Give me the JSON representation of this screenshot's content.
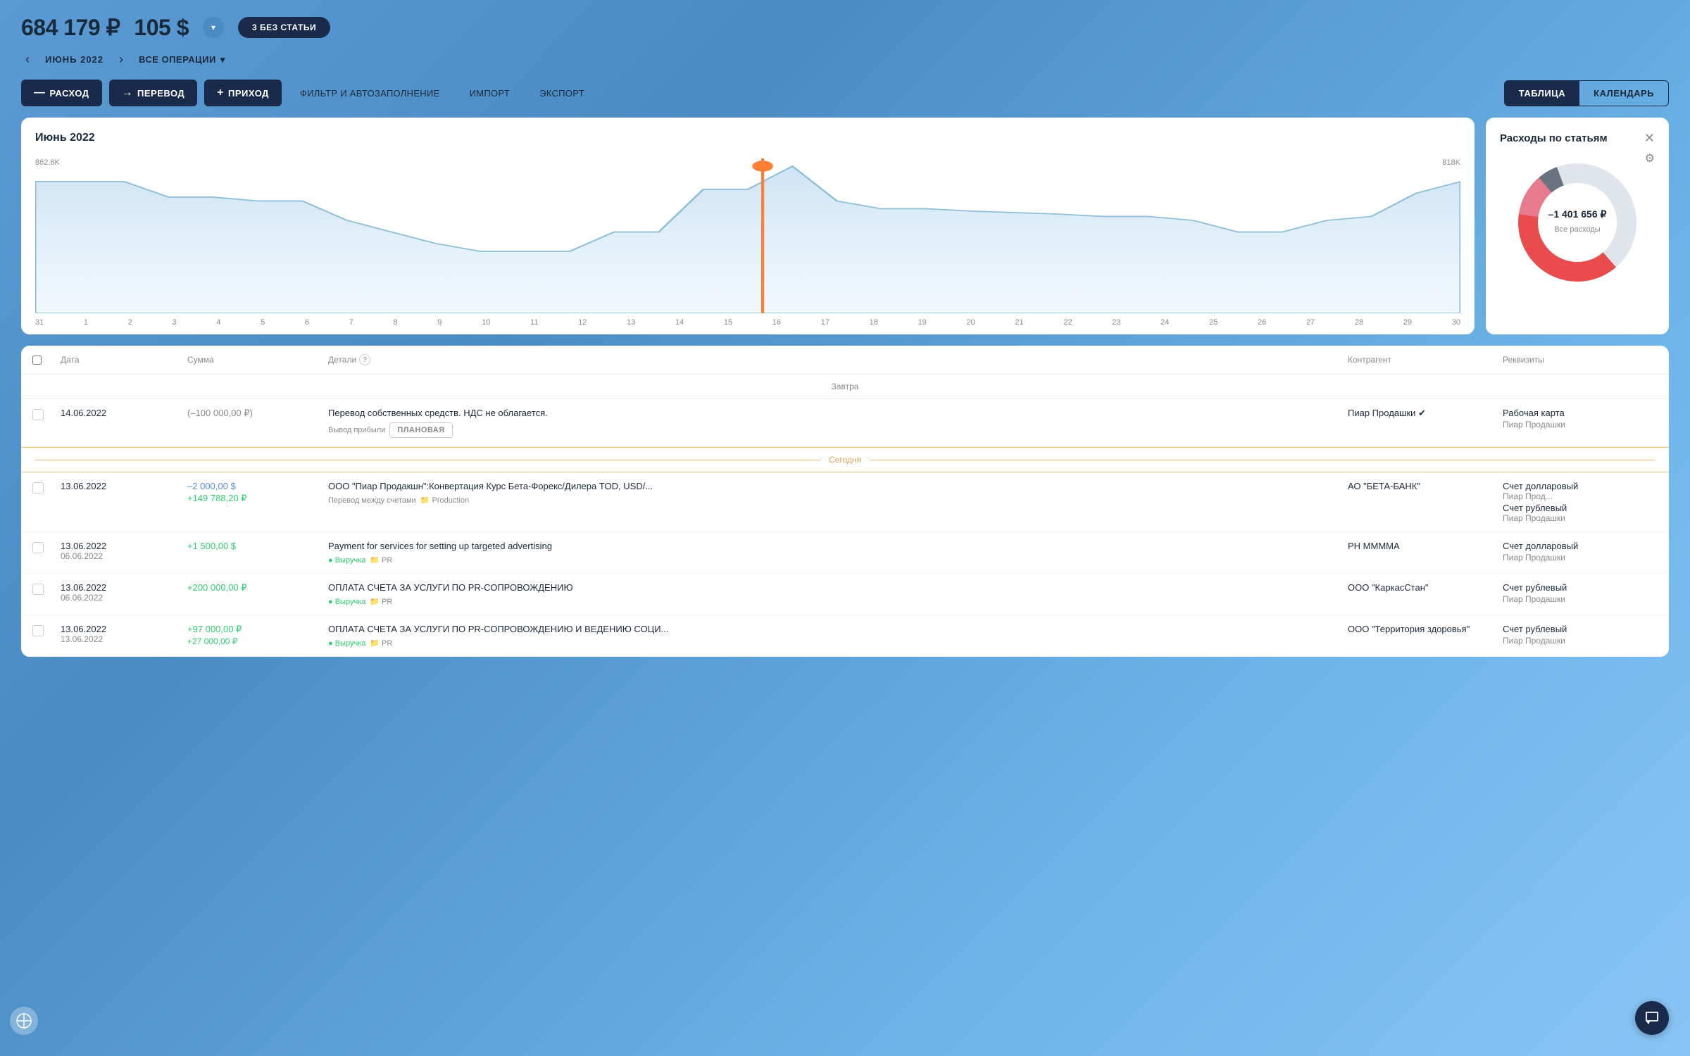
{
  "header": {
    "balance_rub": "684 179 ₽",
    "balance_usd": "105 $",
    "no_article_btn": "3 БЕЗ СТАТЬИ",
    "month": "ИЮНЬ 2022",
    "all_ops": "ВСЕ ОПЕРАЦИИ"
  },
  "toolbar": {
    "expense_btn": "РАСХОД",
    "transfer_btn": "ПЕРЕВОД",
    "income_btn": "ПРИХОД",
    "filter_btn": "ФИЛЬТР И АВТОЗАПОЛНЕНИЕ",
    "import_btn": "ИМПОРТ",
    "export_btn": "ЭКСПОРТ",
    "table_btn": "ТАБЛИЦА",
    "calendar_btn": "КАЛЕНДАРЬ"
  },
  "chart": {
    "title": "Июнь 2022",
    "y_left": "862.6K",
    "y_right": "818K",
    "x_labels": [
      "31",
      "1",
      "2",
      "3",
      "4",
      "5",
      "6",
      "7",
      "8",
      "9",
      "10",
      "11",
      "12",
      "13",
      "14",
      "15",
      "16",
      "17",
      "18",
      "19",
      "20",
      "21",
      "22",
      "23",
      "24",
      "25",
      "26",
      "27",
      "28",
      "29",
      "30"
    ]
  },
  "donut": {
    "title": "Расходы по статьям",
    "amount": "–1 401 656 ₽",
    "subtitle": "Все расходы"
  },
  "table": {
    "headers": {
      "checkbox": "",
      "date": "Дата",
      "amount": "Сумма",
      "details": "Детали",
      "counterparty": "Контрагент",
      "requisites": "Реквизиты"
    },
    "section_tomorrow": "Завтра",
    "section_today": "Сегодня",
    "rows": [
      {
        "date": "14.06.2022",
        "date2": "",
        "amount": "(–100 000,00 ₽)",
        "amount2": "",
        "amount_class": "amount-negative",
        "details_main": "Перевод собственных средств. НДС не облагается.",
        "details_sub": "Вывод прибыли",
        "has_planned": true,
        "counterparty": "Пиар Продашки ✔",
        "req1": "Рабочая карта",
        "req2": "Пиар Продашки"
      },
      {
        "date": "13.06.2022",
        "date2": "",
        "amount": "–2 000,00 $",
        "amount2": "+149 788,20 ₽",
        "amount_class": "amount-blue-neg",
        "amount2_class": "amount-green-pos",
        "details_main": "ООО \"Пиар Продакшн\":Конвертация Курс Бета-Форекс/Дилера TOD, USD/...",
        "details_sub": "Перевод между счетами",
        "has_folder": true,
        "folder_text": "Production",
        "counterparty": "АО \"БЕТА-БАНК\"",
        "req1": "Счет долларовый",
        "req1_sub": "Пиар Прод...",
        "req2": "Счет рублевый",
        "req2_sub": "Пиар Продашки"
      },
      {
        "date": "13.06.2022",
        "date2": "06.06.2022",
        "amount": "+1 500,00 $",
        "amount_class": "amount-positive-green",
        "details_main": "Payment for services for setting up targeted advertising",
        "details_sub_tag": "Выручка",
        "details_sub_folder": "PR",
        "counterparty": "РН ММММА",
        "req1": "Счет долларовый",
        "req1_sub": "Пиар Продашки"
      },
      {
        "date": "13.06.2022",
        "date2": "06.06.2022",
        "amount": "+200 000,00 ₽",
        "amount_class": "amount-positive-green",
        "details_main": "ОПЛАТА СЧЕТА ЗА УСЛУГИ ПО PR-СОПРОВОЖДЕНИЮ",
        "details_sub_tag": "Выручка",
        "details_sub_folder": "PR",
        "counterparty": "ООО \"КаркасСтан\"",
        "req1": "Счет рублевый",
        "req1_sub": "Пиар Продашки"
      },
      {
        "date": "13.06.2022",
        "date2": "13.06.2022",
        "amount": "+97 000,00 ₽",
        "amount2": "+27 000,00 ₽",
        "amount_class": "amount-positive-green",
        "details_main": "ОПЛАТА СЧЕТА ЗА УСЛУГИ ПО PR-СОПРОВОЖДЕНИЮ И ВЕДЕНИЮ СОЦИ...",
        "details_sub_tag": "Выручка",
        "details_sub_folder": "PR",
        "counterparty": "ООО \"Территория здоровья\"",
        "req1": "Счет рублевый",
        "req1_sub": "Пиар Продашки"
      }
    ]
  }
}
